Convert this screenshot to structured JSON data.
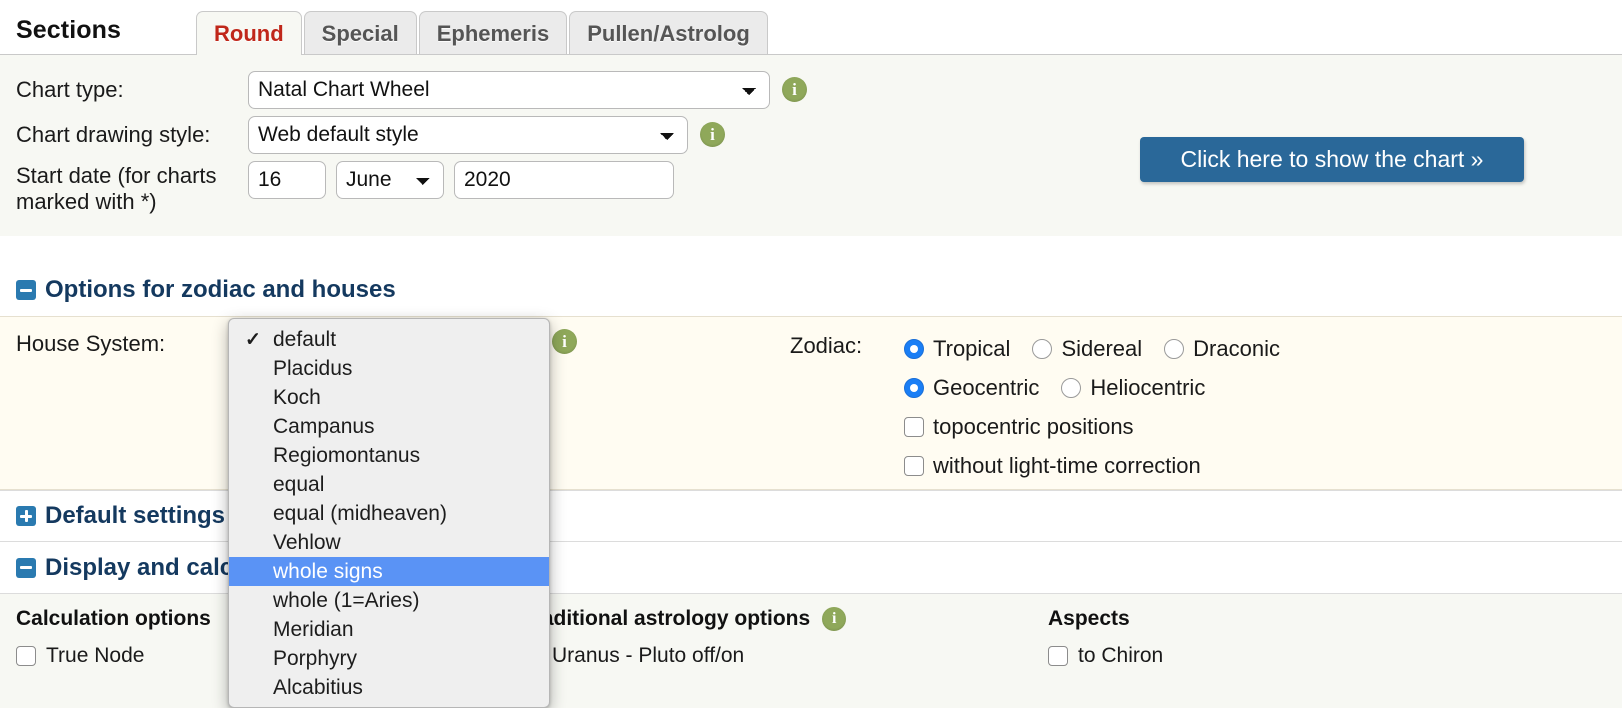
{
  "header": {
    "sections_label": "Sections",
    "tabs": [
      {
        "label": "Round",
        "active": true
      },
      {
        "label": "Special",
        "active": false
      },
      {
        "label": "Ephemeris",
        "active": false
      },
      {
        "label": "Pullen/Astrolog",
        "active": false
      }
    ]
  },
  "top_form": {
    "chart_type_label": "Chart type:",
    "chart_type_value": "Natal Chart Wheel",
    "chart_style_label": "Chart drawing style:",
    "chart_style_value": "Web default style",
    "start_date_label": "Start date (for charts marked with *)",
    "start_day": "16",
    "start_month": "June",
    "start_year": "2020",
    "info_icon": "info-icon",
    "show_chart_button": "Click here to show the chart »"
  },
  "section_zodiac": {
    "heading": "Options for zodiac and houses",
    "toggle_icon": "minus-icon",
    "house_system_label": "House System:",
    "house_system_value": "default",
    "info_icon": "info-icon",
    "zodiac_label": "Zodiac:",
    "zodiac_options": [
      {
        "label": "Tropical",
        "selected": true
      },
      {
        "label": "Sidereal",
        "selected": false
      },
      {
        "label": "Draconic",
        "selected": false
      }
    ],
    "center_options": [
      {
        "label": "Geocentric",
        "selected": true
      },
      {
        "label": "Heliocentric",
        "selected": false
      }
    ],
    "checkboxes": [
      {
        "label": "topocentric positions",
        "checked": false
      },
      {
        "label": "without light-time correction",
        "checked": false
      }
    ]
  },
  "house_dropdown": {
    "open": true,
    "options": [
      {
        "label": "default",
        "checked": true,
        "highlighted": false
      },
      {
        "label": "Placidus",
        "checked": false,
        "highlighted": false
      },
      {
        "label": "Koch",
        "checked": false,
        "highlighted": false
      },
      {
        "label": "Campanus",
        "checked": false,
        "highlighted": false
      },
      {
        "label": "Regiomontanus",
        "checked": false,
        "highlighted": false
      },
      {
        "label": "equal",
        "checked": false,
        "highlighted": false
      },
      {
        "label": "equal (midheaven)",
        "checked": false,
        "highlighted": false
      },
      {
        "label": "Vehlow",
        "checked": false,
        "highlighted": false
      },
      {
        "label": "whole signs",
        "checked": false,
        "highlighted": true
      },
      {
        "label": "whole (1=Aries)",
        "checked": false,
        "highlighted": false
      },
      {
        "label": "Meridian",
        "checked": false,
        "highlighted": false
      },
      {
        "label": "Porphyry",
        "checked": false,
        "highlighted": false
      },
      {
        "label": "Alcabitius",
        "checked": false,
        "highlighted": false
      }
    ]
  },
  "section_default": {
    "heading": "Default settings",
    "toggle_icon": "plus-icon"
  },
  "section_display": {
    "heading": "Display and calculation options",
    "toggle_icon": "minus-icon"
  },
  "bottom_columns": {
    "calculation": {
      "title": "Calculation options",
      "options": [
        {
          "label": "True Node",
          "checked": false
        }
      ]
    },
    "traditional": {
      "title": "Traditional astrology options",
      "info_icon": "info-icon",
      "options": [
        {
          "label": "Uranus - Pluto off/on",
          "checked": false
        }
      ]
    },
    "aspects": {
      "title": "Aspects",
      "options": [
        {
          "label": "to Chiron",
          "checked": false
        }
      ]
    }
  },
  "colors": {
    "accent_button": "#2a6899",
    "active_tab_text": "#c0271a",
    "heading": "#14395f",
    "info_icon": "#8fa85a",
    "dropdown_highlight": "#5a93f5",
    "radio_on": "#1a7ef5",
    "panel_top_bg": "#f7f8f3",
    "panel_cream_bg": "#fffcf2"
  }
}
